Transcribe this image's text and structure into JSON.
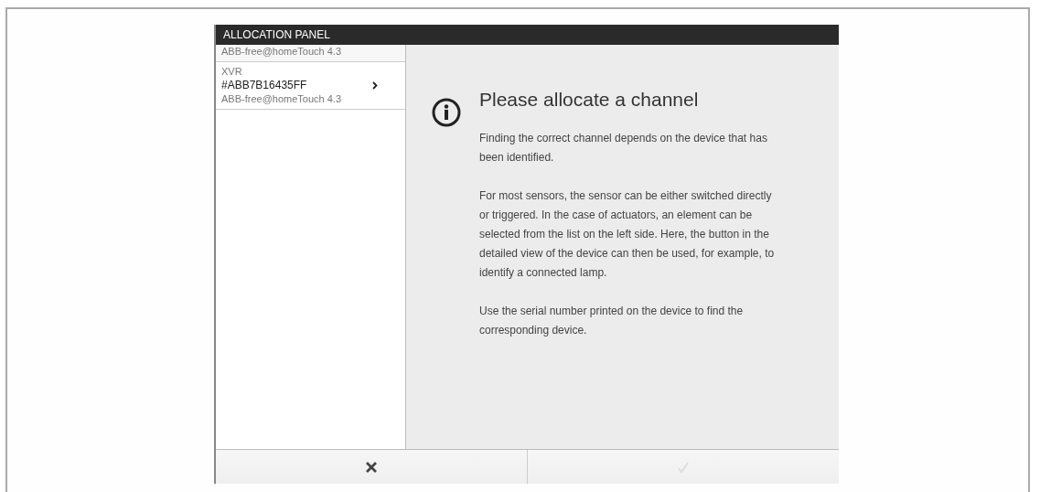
{
  "panel": {
    "title": "ALLOCATION PANEL"
  },
  "sidebar": {
    "group_label": "ABB-free@homeTouch 4.3",
    "items": [
      {
        "type": "XVR",
        "serial": "#ABB7B16435FF",
        "subtitle": "ABB-free@homeTouch 4.3"
      }
    ]
  },
  "message": {
    "title": "Please allocate a channel",
    "paragraphs": [
      "Finding the correct channel depends on the device that has been identified.",
      "For most sensors, the sensor can be either switched directly or triggered. In the case of actuators, an element can be selected from the list on the left side. Here, the button in the detailed view of the device can then be used, for example, to identify a connected lamp.",
      "Use the serial number printed on the device to find the corresponding device."
    ]
  },
  "buttons": [
    {
      "kind": "cancel",
      "disabled": false
    },
    {
      "kind": "confirm",
      "disabled": true
    }
  ]
}
